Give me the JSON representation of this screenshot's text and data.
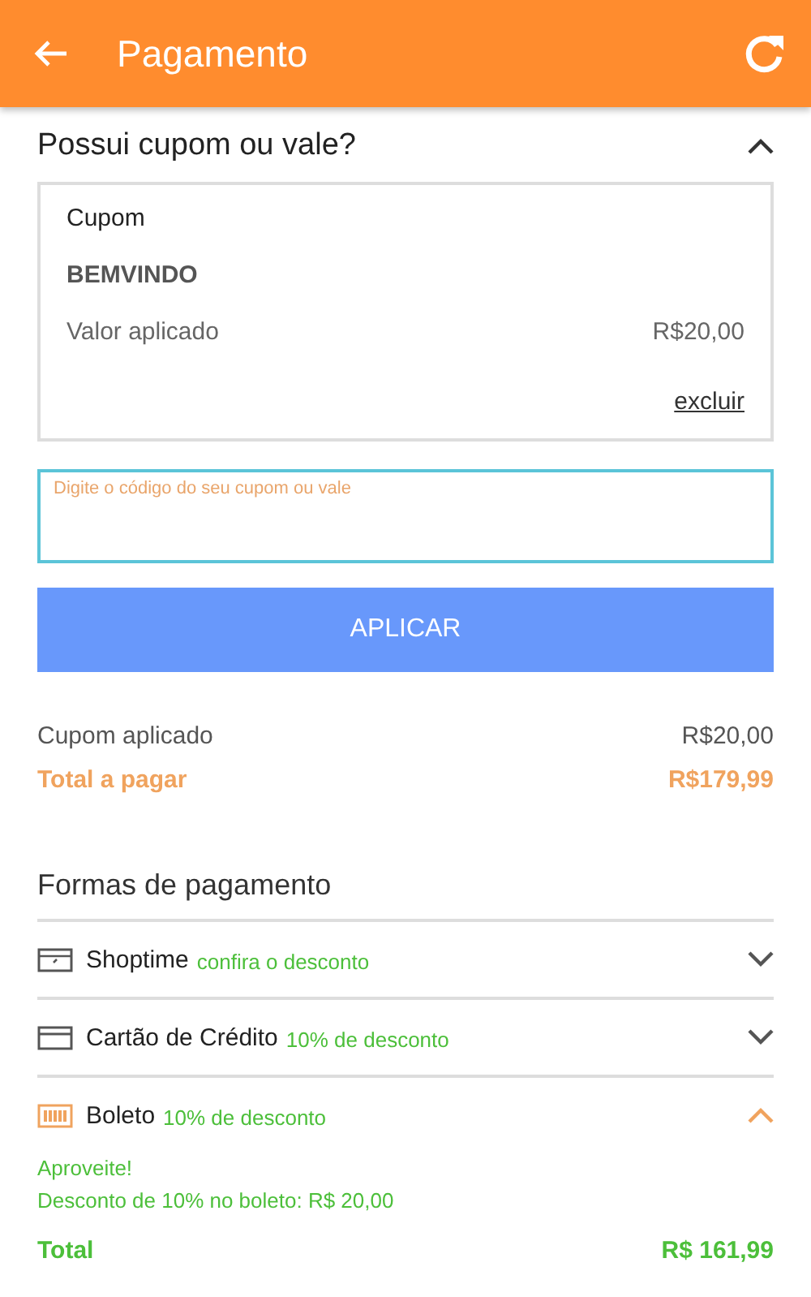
{
  "header": {
    "title": "Pagamento"
  },
  "coupon_section": {
    "title": "Possui cupom ou vale?",
    "expanded": true,
    "applied_coupon": {
      "label": "Cupom",
      "code": "BEMVINDO",
      "value_label": "Valor aplicado",
      "value": "R$20,00",
      "remove_link": "excluir"
    },
    "code_field": {
      "placeholder": "Digite o código do seu cupom ou vale",
      "focused": true
    },
    "apply_button": "APLICAR"
  },
  "summary": [
    {
      "label": "Cupom aplicado",
      "value": "R$20,00",
      "emphasis": false
    },
    {
      "label": "Total a pagar",
      "value": "R$179,99",
      "emphasis": true
    }
  ],
  "payment_section": {
    "title": "Formas de pagamento",
    "methods": [
      {
        "kind": "shoptime",
        "name": "Shoptime",
        "note": "confira o desconto",
        "expanded": false
      },
      {
        "kind": "card",
        "name": "Cartão de Crédito",
        "note": "10% de desconto",
        "expanded": false
      },
      {
        "kind": "boleto",
        "name": "Boleto",
        "note": "10% de desconto",
        "expanded": true,
        "details": [
          "Aproveite!",
          "Desconto de 10% no boleto: R$ 20,00"
        ],
        "total_label": "Total",
        "total_value": "R$ 161,99"
      }
    ]
  }
}
